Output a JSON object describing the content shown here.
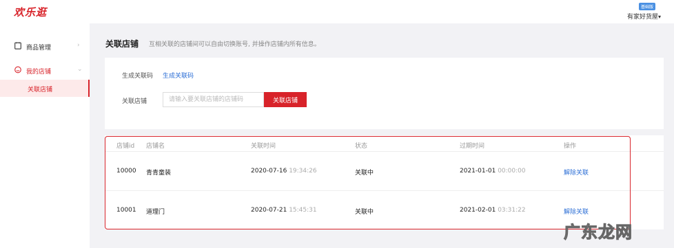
{
  "header": {
    "logo": "欢乐逛",
    "edition_badge": "基础版",
    "shop_name": "有家好货屋",
    "shop_caret": "▾"
  },
  "sidebar": {
    "items": [
      {
        "label": "商品管理",
        "icon": "document-icon",
        "arrow": "›"
      },
      {
        "label": "我的店铺",
        "icon": "smile-icon",
        "arrow": "⌄"
      }
    ],
    "sub_item": "关联店铺"
  },
  "page": {
    "title": "关联店铺",
    "description": "互相关联的店铺间可以自由切换账号, 并操作店铺内所有信息。"
  },
  "form": {
    "code_label": "生成关联码",
    "code_link": "生成关联码",
    "shop_label": "关联店铺",
    "shop_placeholder": "请输入要关联店铺的店铺码",
    "submit_label": "关联店铺"
  },
  "table": {
    "columns": [
      "店铺id",
      "店铺名",
      "关联时间",
      "状态",
      "过期时间",
      "操作"
    ],
    "rows": [
      {
        "id": "10000",
        "name": "青青童装",
        "linked_date": "2020-07-16",
        "linked_time": "19:34:26",
        "status": "关联中",
        "expire_date": "2021-01-01",
        "expire_time": "00:00:00",
        "action": "解除关联"
      },
      {
        "id": "10001",
        "name": "道理门",
        "linked_date": "2020-07-21",
        "linked_time": "15:45:31",
        "status": "关联中",
        "expire_date": "2021-02-01",
        "expire_time": "03:31:22",
        "action": "解除关联"
      }
    ]
  },
  "watermark": "广东龙网",
  "colors": {
    "accent": "#d8232a",
    "link": "#2d6fd6",
    "badge": "#4a90e2"
  }
}
